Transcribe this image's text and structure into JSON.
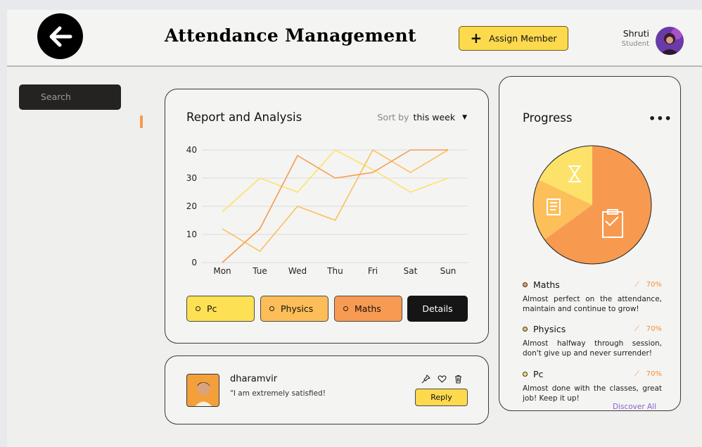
{
  "header": {
    "title": "Attendance Management",
    "assign_label": "Assign Member",
    "user_name": "Shruti",
    "user_role": "Student"
  },
  "search": {
    "placeholder": "Search"
  },
  "report": {
    "title": "Report and Analysis",
    "sort_label": "Sort by",
    "sort_value": "this week",
    "legend": [
      "Pc",
      "Physics",
      "Maths"
    ],
    "details_label": "Details"
  },
  "chart_data": {
    "type": "line",
    "categories": [
      "Mon",
      "Tue",
      "Wed",
      "Thu",
      "Fri",
      "Sat",
      "Sun"
    ],
    "yticks": [
      0,
      10,
      20,
      30,
      40
    ],
    "ylim": [
      0,
      40
    ],
    "series": [
      {
        "name": "Pc",
        "color": "#fde26a",
        "values": [
          18,
          30,
          25,
          40,
          33,
          25,
          30
        ]
      },
      {
        "name": "Physics",
        "color": "#fdbf5a",
        "values": [
          12,
          4,
          20,
          15,
          40,
          32,
          40
        ]
      },
      {
        "name": "Maths",
        "color": "#f79a4f",
        "values": [
          0,
          12,
          38,
          30,
          32,
          40,
          40
        ]
      }
    ],
    "grid": true
  },
  "comment": {
    "name": "dharamvir",
    "text": "\"I am extremely satisfied!",
    "reply_label": "Reply"
  },
  "progress": {
    "title": "Progress",
    "menu": "•••",
    "subjects": [
      {
        "name": "Maths",
        "percent": "70%",
        "color": "#f79a4f",
        "desc": "Almost perfect on the attendance, maintain and continue to grow!"
      },
      {
        "name": "Physics",
        "percent": "70%",
        "color": "#fdbf5a",
        "desc": "Almost halfway through session, don't give up and never surrender!"
      },
      {
        "name": "Pc",
        "percent": "70%",
        "color": "#fde26a",
        "desc": "Almost done with the classes, great job! Keep it up!"
      }
    ],
    "pie_values": [
      65,
      17,
      18
    ],
    "discover_label": "Discover All"
  }
}
